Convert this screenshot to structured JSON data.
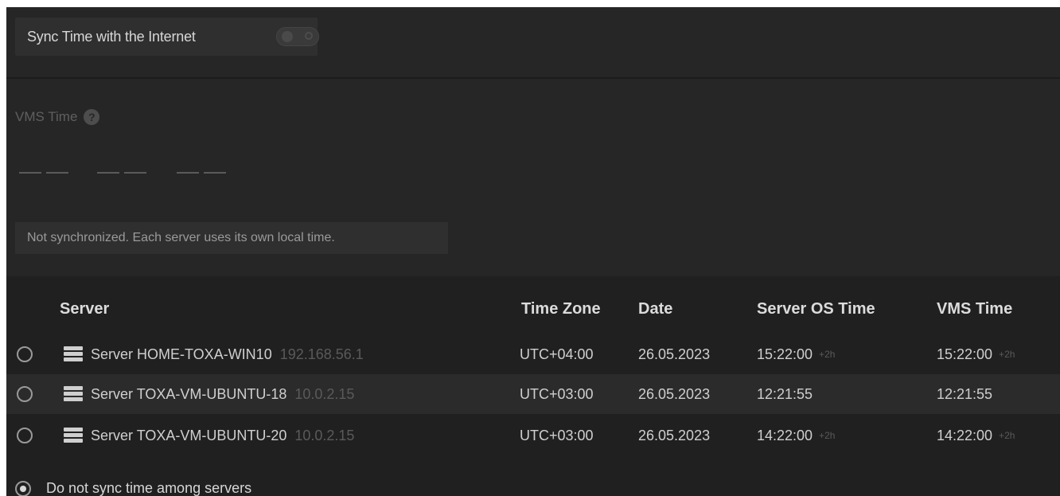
{
  "sync": {
    "label": "Sync Time with the Internet",
    "enabled": false
  },
  "vms_time": {
    "label": "VMS Time",
    "help_icon": "question-circle-icon",
    "value_placeholder": "-- -- --"
  },
  "status_notice": "Not synchronized. Each server uses its own local time.",
  "table": {
    "columns": [
      "Server",
      "Time Zone",
      "Date",
      "Server OS Time",
      "VMS Time"
    ],
    "rows": [
      {
        "selected": false,
        "icon": "server-icon",
        "name": "Server HOME-TOXA-WIN10",
        "ip": "192.168.56.1",
        "timezone": "UTC+04:00",
        "date": "26.05.2023",
        "os_time": "15:22:00",
        "os_offset": "+2h",
        "vms_time": "15:22:00",
        "vms_offset": "+2h"
      },
      {
        "selected": false,
        "icon": "server-icon",
        "name": "Server TOXA-VM-UBUNTU-18",
        "ip": "10.0.2.15",
        "timezone": "UTC+03:00",
        "date": "26.05.2023",
        "os_time": "12:21:55",
        "os_offset": "",
        "vms_time": "12:21:55",
        "vms_offset": ""
      },
      {
        "selected": false,
        "icon": "server-icon",
        "name": "Server TOXA-VM-UBUNTU-20",
        "ip": "10.0.2.15",
        "timezone": "UTC+03:00",
        "date": "26.05.2023",
        "os_time": "14:22:00",
        "os_offset": "+2h",
        "vms_time": "14:22:00",
        "vms_offset": "+2h"
      }
    ]
  },
  "no_sync_option": {
    "label": "Do not sync time among servers",
    "selected": true
  }
}
